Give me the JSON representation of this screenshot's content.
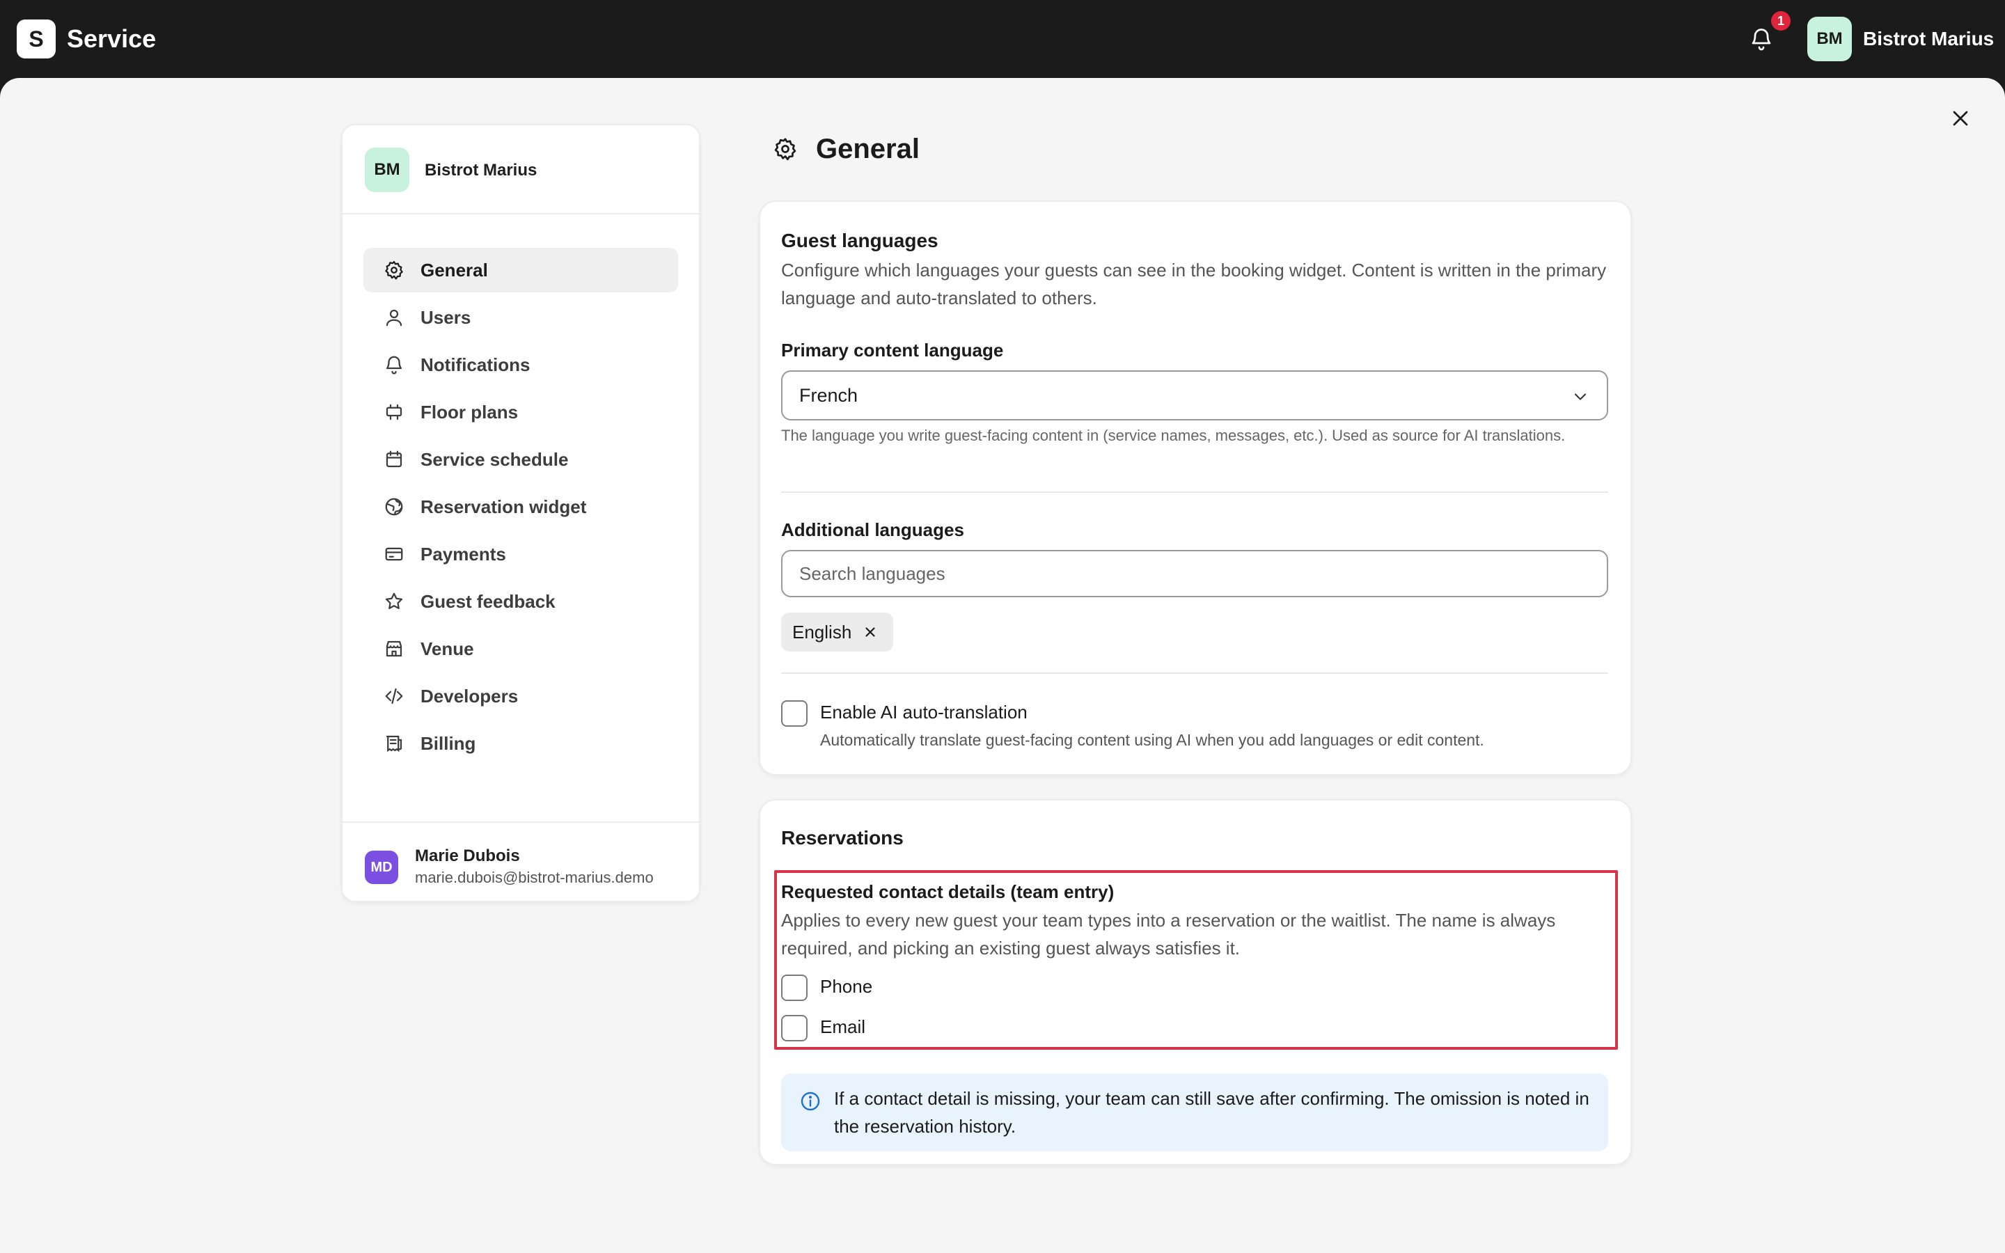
{
  "app": {
    "logo_letter": "S",
    "title": "Service"
  },
  "topbar": {
    "notification_count": "1",
    "avatar_initials": "BM",
    "org_name": "Bistrot Marius"
  },
  "sidebar": {
    "org_initials": "BM",
    "org_name": "Bistrot Marius",
    "items": [
      {
        "label": "General",
        "icon": "gear-icon",
        "active": true
      },
      {
        "label": "Users",
        "icon": "user-icon"
      },
      {
        "label": "Notifications",
        "icon": "bell-icon"
      },
      {
        "label": "Floor plans",
        "icon": "floor-plan-icon"
      },
      {
        "label": "Service schedule",
        "icon": "calendar-icon"
      },
      {
        "label": "Reservation widget",
        "icon": "globe-icon"
      },
      {
        "label": "Payments",
        "icon": "credit-card-icon"
      },
      {
        "label": "Guest feedback",
        "icon": "star-icon"
      },
      {
        "label": "Venue",
        "icon": "store-icon"
      },
      {
        "label": "Developers",
        "icon": "code-icon"
      },
      {
        "label": "Billing",
        "icon": "receipt-icon"
      }
    ],
    "user": {
      "initials": "MD",
      "name": "Marie Dubois",
      "email": "marie.dubois@bistrot-marius.demo"
    }
  },
  "page": {
    "title": "General"
  },
  "guest_languages": {
    "title": "Guest languages",
    "description": "Configure which languages your guests can see in the booking widget. Content is written in the primary language and auto-translated to others.",
    "primary_label": "Primary content language",
    "primary_value": "French",
    "primary_helper": "The language you write guest-facing content in (service names, messages, etc.). Used as source for AI translations.",
    "additional_label": "Additional languages",
    "search_placeholder": "Search languages",
    "selected_languages": [
      "English"
    ],
    "auto_translate_label": "Enable AI auto-translation",
    "auto_translate_help": "Automatically translate guest-facing content using AI when you add languages or edit content.",
    "auto_translate_checked": false
  },
  "reservations": {
    "title": "Reservations",
    "contact_title": "Requested contact details (team entry)",
    "contact_description": "Applies to every new guest your team types into a reservation or the waitlist. The name is always required, and picking an existing guest always satisfies it.",
    "phone_label": "Phone",
    "email_label": "Email",
    "phone_checked": false,
    "email_checked": false,
    "info_text": "If a contact detail is missing, your team can still save after confirming. The omission is noted in the reservation history."
  },
  "colors": {
    "topbar": "#1b1b1b",
    "accent_avatar": "#c9f2de",
    "user_avatar": "#7b4fe0",
    "highlight": "#d6344a",
    "badge": "#e0243b",
    "info_bg": "#e8f3fe"
  }
}
